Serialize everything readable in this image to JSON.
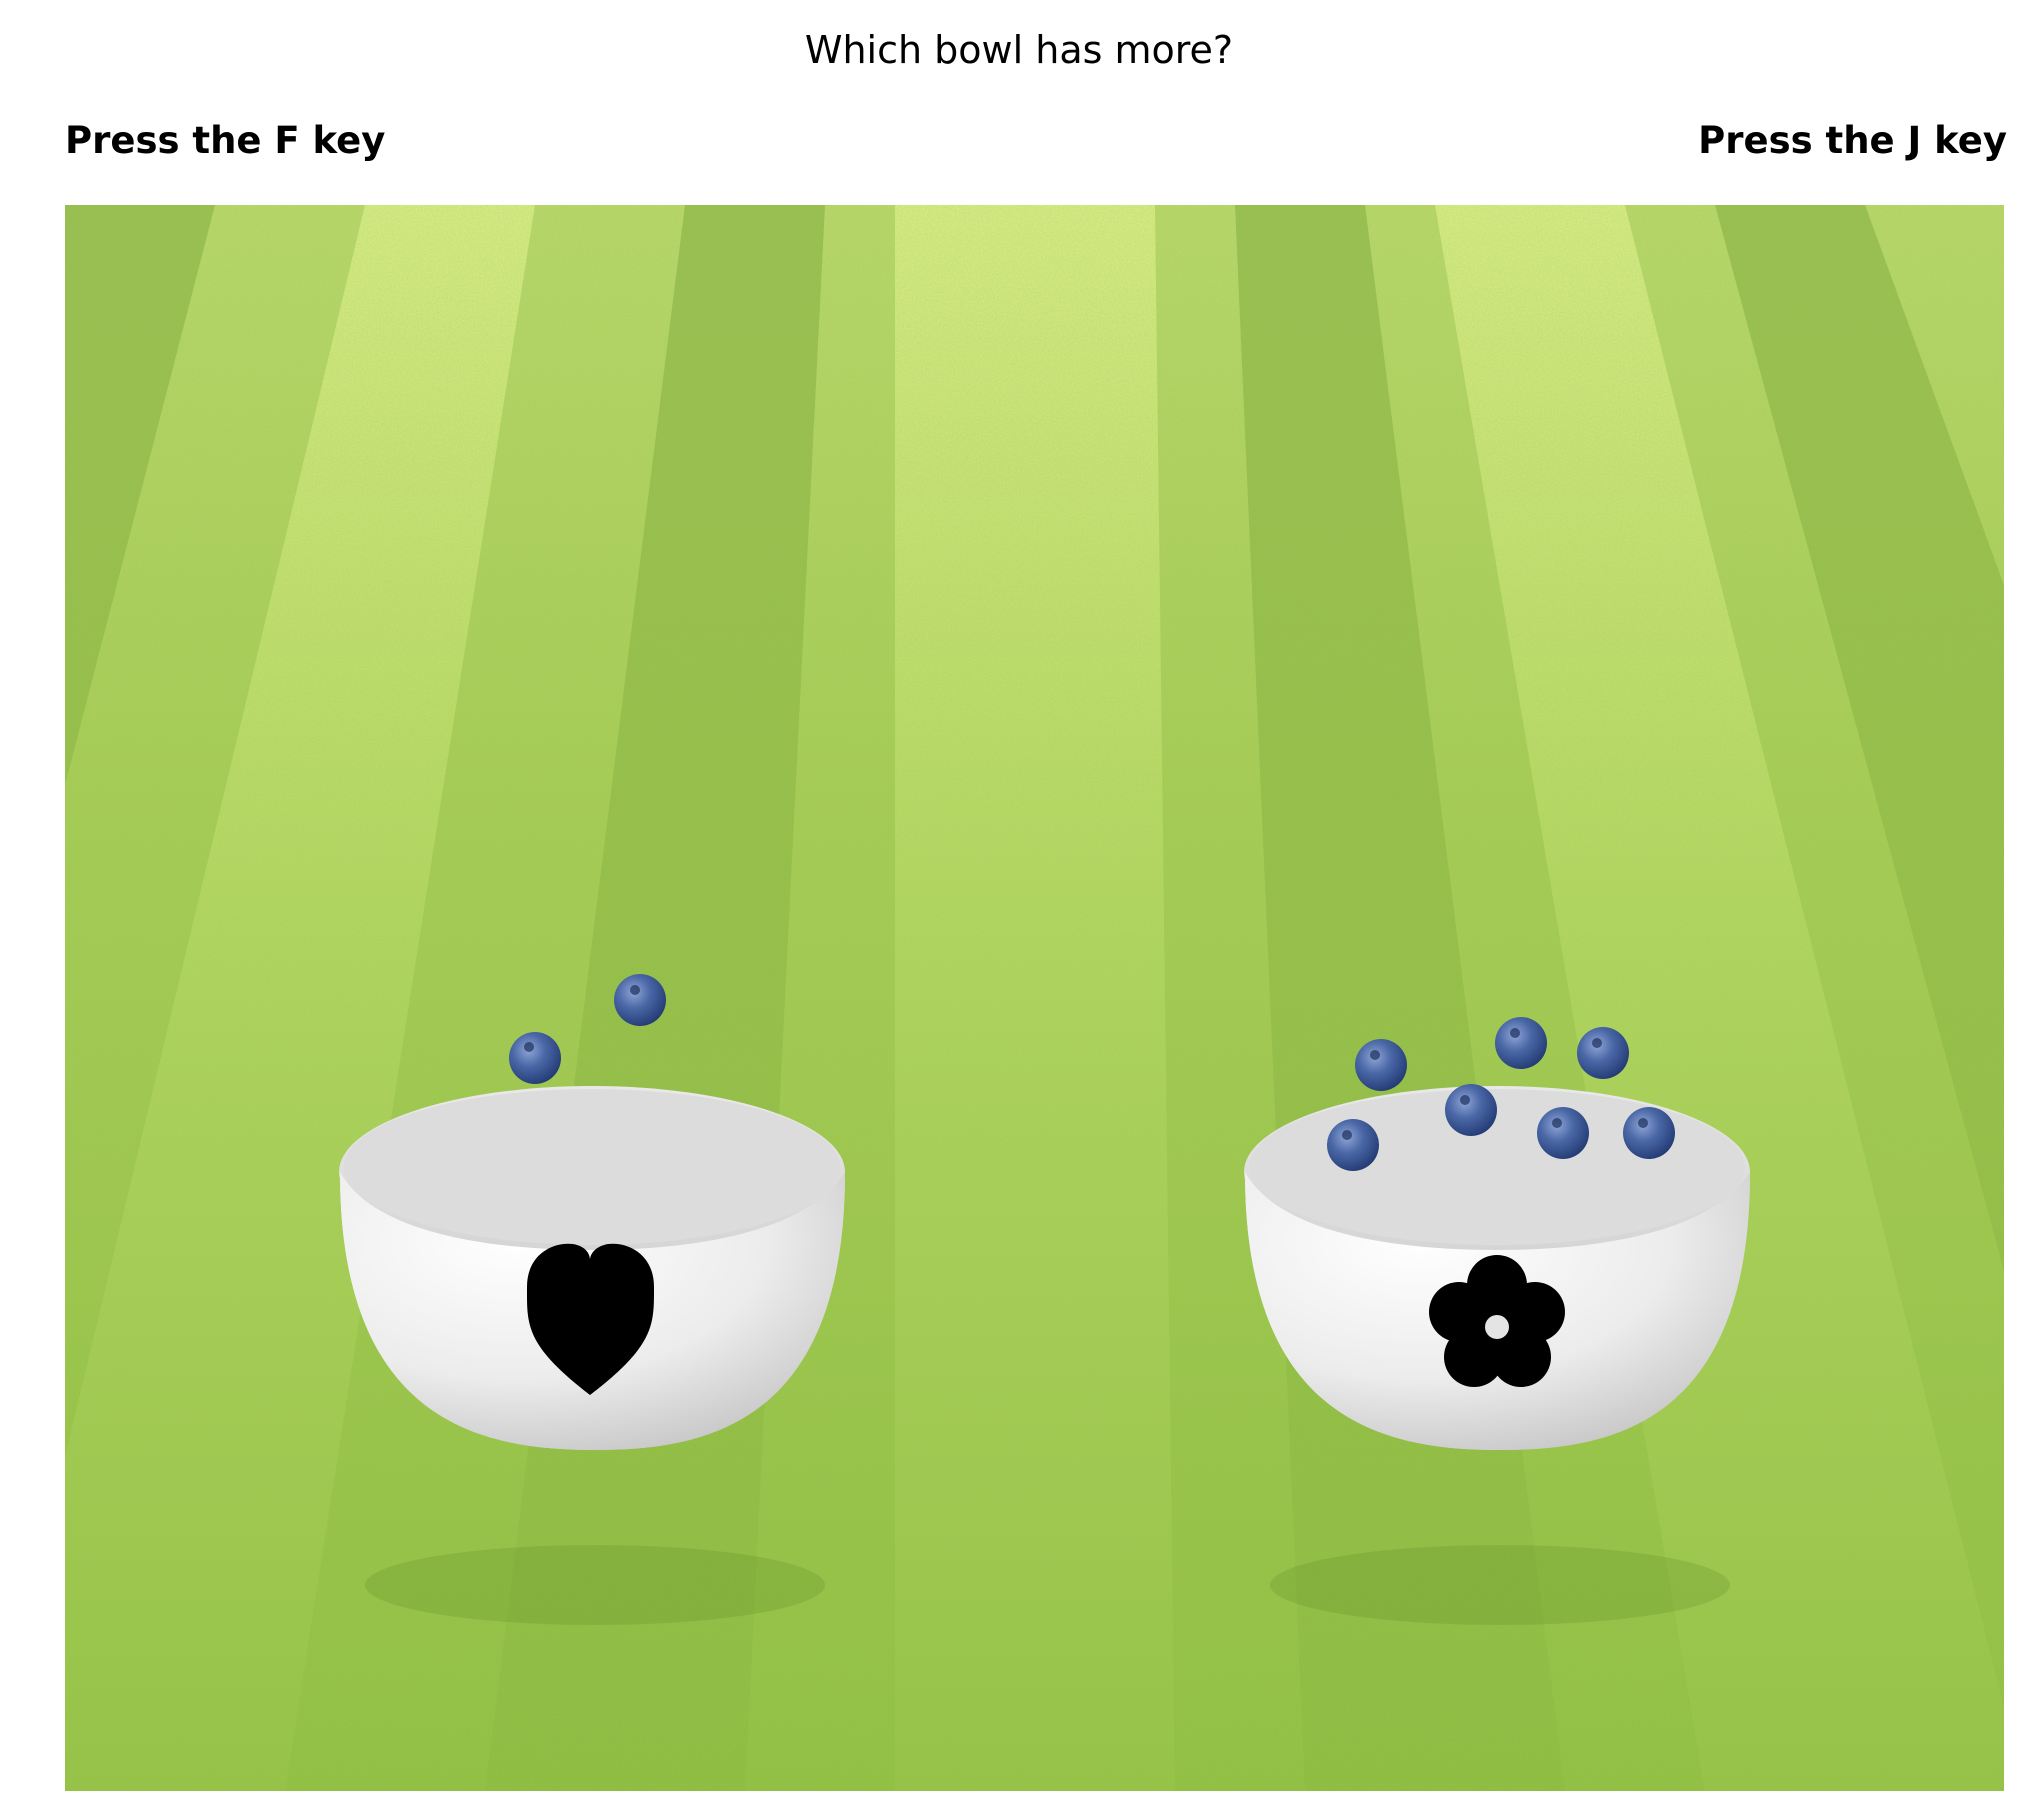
{
  "prompt": "Which bowl has more?",
  "left_choice": {
    "key_label": "Press the F key",
    "bowl_symbol": "heart-icon",
    "item_count": 2,
    "item": "blueberry"
  },
  "right_choice": {
    "key_label": "Press the J key",
    "bowl_symbol": "flower-icon",
    "item_count": 7,
    "item": "blueberry"
  },
  "colors": {
    "grass_light": "#cfe882",
    "grass_dark": "#7fb33a",
    "blueberry": "#3d5c99",
    "bowl": "#efefef",
    "symbol": "#000000"
  }
}
